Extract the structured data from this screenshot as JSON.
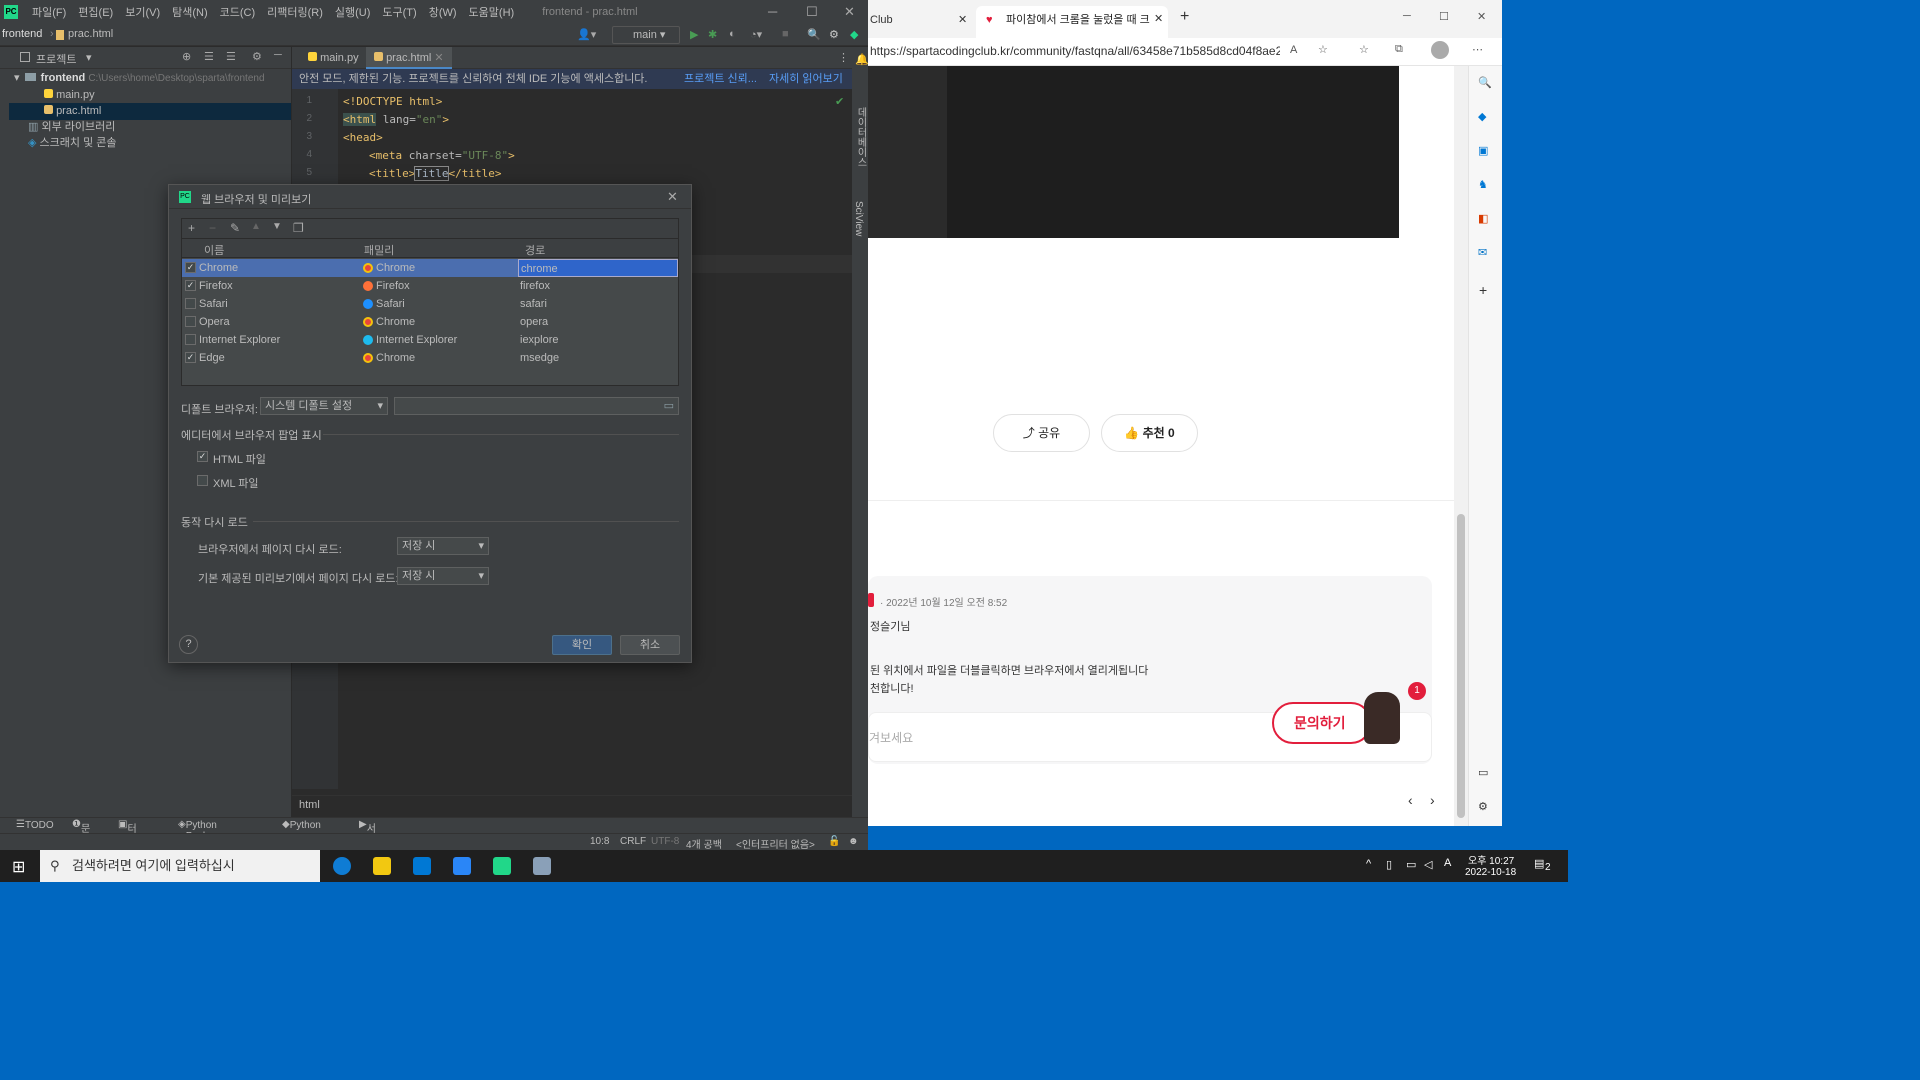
{
  "ide": {
    "menu": [
      "파일(F)",
      "편집(E)",
      "보기(V)",
      "탐색(N)",
      "코드(C)",
      "리팩터링(R)",
      "실행(U)",
      "도구(T)",
      "창(W)",
      "도움말(H)"
    ],
    "window_title": "frontend - prac.html",
    "breadcrumb": {
      "project": "frontend",
      "file": "prac.html"
    },
    "run_config": "main",
    "project_panel": {
      "title": "프로젝트",
      "root": "frontend",
      "root_path": "C:\\Users\\home\\Desktop\\sparta\\frontend",
      "files": [
        "main.py",
        "prac.html"
      ],
      "external": "외부 라이브러리",
      "scratches": "스크래치 및 콘솔"
    },
    "tabs": [
      "main.py",
      "prac.html"
    ],
    "notice": {
      "text": "안전 모드, 제한된 기능. 프로젝트를 신뢰하여 전체 IDE 기능에 액세스합니다.",
      "link1": "프로젝트 신뢰...",
      "link2": "자세히 읽어보기"
    },
    "code_lines": [
      "1",
      "2",
      "3",
      "4",
      "5"
    ],
    "code": {
      "l1": "<!DOCTYPE html>",
      "l2a": "<html",
      "l2b": " lang=",
      "l2c": "\"en\"",
      "l2d": ">",
      "l3": "<head>",
      "l4a": "<meta",
      "l4b": " charset=",
      "l4c": "\"UTF-8\"",
      "l4d": ">",
      "l5a": "<title>",
      "l5b": "Title",
      "l5c": "</title>"
    },
    "footer_path": "html",
    "bottom_tools": [
      "TODO",
      "문제",
      "터미널",
      "Python Packages",
      "Python 콘솔",
      "서비스"
    ],
    "status": {
      "pos": "10:8",
      "eol": "CRLF",
      "enc": "UTF-8",
      "indent": "4개 공백",
      "interp": "<인터프리터 없음>"
    },
    "right_strip": [
      "데이터베이스",
      "SciView"
    ]
  },
  "dialog": {
    "title": "웹 브라우저 및 미리보기",
    "columns": [
      "이름",
      "패밀리",
      "경로"
    ],
    "rows": [
      {
        "name": "Chrome",
        "family": "Chrome",
        "path": "chrome",
        "checked": "✓",
        "icon": "#e8453c"
      },
      {
        "name": "Firefox",
        "family": "Firefox",
        "path": "firefox",
        "checked": "✓",
        "icon": "#ff7139"
      },
      {
        "name": "Safari",
        "family": "Safari",
        "path": "safari",
        "checked": "",
        "icon": "#1e90ff"
      },
      {
        "name": "Opera",
        "family": "Chrome",
        "path": "opera",
        "checked": "",
        "icon": "#e8453c"
      },
      {
        "name": "Internet Explorer",
        "family": "Internet Explorer",
        "path": "iexplore",
        "checked": "",
        "icon": "#1ebbee"
      },
      {
        "name": "Edge",
        "family": "Chrome",
        "path": "msedge",
        "checked": "✓",
        "icon": "#e8453c"
      }
    ],
    "default_label": "디폴트 브라우저:",
    "default_value": "시스템 디폴트 설정",
    "popup_section": "에디터에서 브라우저 팝업 표시",
    "html_files": "HTML 파일",
    "xml_files": "XML 파일",
    "html_checked": "✓",
    "reload_section": "동작 다시 로드",
    "reload_browser": "브라우저에서 페이지 다시 로드:",
    "reload_browser_val": "저장 시",
    "reload_preview": "기본 제공된 미리보기에서 페이지 다시 로드:",
    "reload_preview_val": "저장 시",
    "help": "?",
    "ok": "확인",
    "cancel": "취소"
  },
  "browser": {
    "tab1": "Club",
    "tab2": "파이참에서 크롬을 눌렀을 때 크",
    "url": "https://spartacodingclub.kr/community/fastqna/all/63458e71b585d8cd04f8ae2f/...",
    "share": "공유",
    "like": "추천 0",
    "comment_date": "2022년 10월 12일 오전 8:52",
    "comment_name": "정슬기님",
    "comment_text": "된 위치에서 파일을 더블클릭하면 브라우저에서 열리게됩니다",
    "comment_text2": "천합니다!",
    "input_placeholder": "겨보세요",
    "ask": "문의하기",
    "badge": "1"
  },
  "taskbar": {
    "search": "검색하려면 여기에 입력하십시",
    "time": "오후 10:27",
    "date": "2022-10-18",
    "notif": "2"
  }
}
